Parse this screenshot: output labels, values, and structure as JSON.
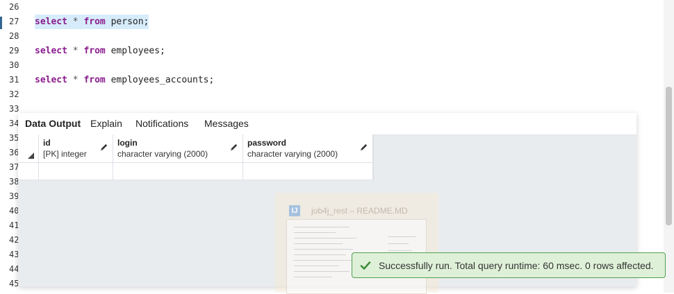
{
  "editor": {
    "lines": [
      {
        "num": "26",
        "kw1": "",
        "op": "",
        "kw2": "",
        "rest": ""
      },
      {
        "num": "27",
        "kw1": "select",
        "op": " * ",
        "kw2": "from",
        "rest": " person;"
      },
      {
        "num": "28",
        "kw1": "",
        "op": "",
        "kw2": "",
        "rest": ""
      },
      {
        "num": "29",
        "kw1": "select",
        "op": " * ",
        "kw2": "from",
        "rest": " employees;"
      },
      {
        "num": "30",
        "kw1": "",
        "op": "",
        "kw2": "",
        "rest": ""
      },
      {
        "num": "31",
        "kw1": "select",
        "op": " * ",
        "kw2": "from",
        "rest": " employees_accounts;"
      },
      {
        "num": "32",
        "kw1": "",
        "op": "",
        "kw2": "",
        "rest": ""
      },
      {
        "num": "33",
        "kw1": "",
        "op": "",
        "kw2": "",
        "rest": ""
      },
      {
        "num": "34",
        "kw1": "",
        "op": "",
        "kw2": "",
        "rest": ""
      },
      {
        "num": "35",
        "kw1": "",
        "op": "",
        "kw2": "",
        "rest": ""
      },
      {
        "num": "36",
        "kw1": "",
        "op": "",
        "kw2": "",
        "rest": ""
      },
      {
        "num": "37",
        "kw1": "",
        "op": "",
        "kw2": "",
        "rest": ""
      },
      {
        "num": "38",
        "kw1": "",
        "op": "",
        "kw2": "",
        "rest": ""
      },
      {
        "num": "39",
        "kw1": "",
        "op": "",
        "kw2": "",
        "rest": ""
      },
      {
        "num": "40",
        "kw1": "",
        "op": "",
        "kw2": "",
        "rest": ""
      },
      {
        "num": "41",
        "kw1": "",
        "op": "",
        "kw2": "",
        "rest": ""
      },
      {
        "num": "42",
        "kw1": "",
        "op": "",
        "kw2": "",
        "rest": ""
      },
      {
        "num": "43",
        "kw1": "",
        "op": "",
        "kw2": "",
        "rest": ""
      },
      {
        "num": "44",
        "kw1": "",
        "op": "",
        "kw2": "",
        "rest": ""
      },
      {
        "num": "45",
        "kw1": "",
        "op": "",
        "kw2": "",
        "rest": ""
      }
    ],
    "highlighted_line": "27"
  },
  "results": {
    "tabs": [
      {
        "label": "Data Output",
        "active": true
      },
      {
        "label": "Explain",
        "active": false
      },
      {
        "label": "Notifications",
        "active": false
      },
      {
        "label": "Messages",
        "active": false
      }
    ],
    "columns": [
      {
        "name": "id",
        "type": "[PK] integer"
      },
      {
        "name": "login",
        "type": "character varying (2000)"
      },
      {
        "name": "password",
        "type": "character varying (2000)"
      }
    ],
    "rows": [
      [
        "",
        "",
        ""
      ]
    ]
  },
  "ghost_window": {
    "icon_label": "IJ",
    "title": "job4j_rest – README.MD"
  },
  "toast": {
    "message": "Successfully run. Total query runtime: 60 msec. 0 rows affected."
  },
  "icons": {
    "edit": "pencil-icon",
    "success": "check-icon",
    "select_all": "corner-triangle-icon"
  },
  "colors": {
    "keyword": "#8a1c8e",
    "selection": "#d7ecfb",
    "toast_border": "#4ea04e",
    "toast_bg": "#dff0d8"
  }
}
